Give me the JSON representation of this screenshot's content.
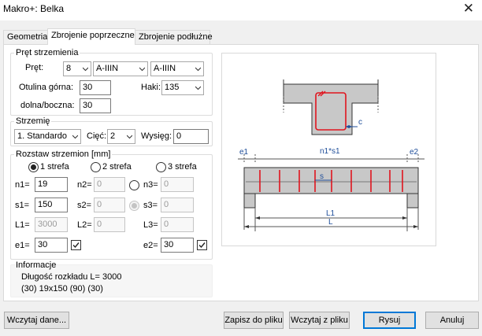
{
  "window": {
    "title": "Makro+: Belka",
    "close_glyph": "✕"
  },
  "tabs": [
    {
      "label": "Geometria"
    },
    {
      "label": "Zbrojenie poprzeczne"
    },
    {
      "label": "Zbrojenie podłużne"
    }
  ],
  "active_tab": 1,
  "pret": {
    "legend": "Pręt strzemienia",
    "pret_label": "Pręt:",
    "pret_value": "8",
    "steel1": "A-IIIN",
    "steel2": "A-IIIN",
    "otulina_gorna_label": "Otulina górna:",
    "otulina_gorna_value": "30",
    "haki_label": "Haki:",
    "haki_value": "135",
    "dolna_label": "dolna/boczna:",
    "dolna_value": "30"
  },
  "strzemie": {
    "legend": "Strzemię",
    "type_value": "1. Standardo",
    "ciec_label": "Cięć:",
    "ciec_value": "2",
    "wysieg_label": "Wysięg:",
    "wysieg_value": "0"
  },
  "rozstaw": {
    "legend": "Rozstaw strzemion [mm]",
    "strefa1": "1 strefa",
    "strefa2": "2 strefa",
    "strefa3": "3 strefa",
    "selected_strefa": 1,
    "n1_label": "n1=",
    "n1": "19",
    "n2_label": "n2=",
    "n2": "0",
    "n3_label": "n3=",
    "n3": "0",
    "s1_label": "s1=",
    "s1": "150",
    "s2_label": "s2=",
    "s2": "0",
    "s3_label": "s3=",
    "s3": "0",
    "L1_label": "L1=",
    "L1": "3000",
    "L2_label": "L2=",
    "L2": "0",
    "L3_label": "L3=",
    "L3": "0",
    "e1_label": "e1=",
    "e1": "30",
    "e1_checked": true,
    "e2_label": "e2=",
    "e2": "30",
    "e2_checked": true
  },
  "informacje": {
    "legend": "Informacje",
    "line1": "Długość rozkładu L= 3000",
    "line2": "(30) 19x150 (90) (30)"
  },
  "diagram": {
    "label_c": "c",
    "label_e1": "e1",
    "label_e2": "e2",
    "label_ns": "n1*s1",
    "label_s": "s",
    "label_L1": "L1",
    "label_L": "L",
    "colors": {
      "rebar": "#e0141e",
      "dim": "#1f4e9a",
      "concrete": "#c8c8c8",
      "outline": "#333333"
    }
  },
  "buttons": {
    "wczytaj_dane": "Wczytaj dane...",
    "zapisz": "Zapisz do pliku",
    "wczytaj_z_pliku": "Wczytaj z pliku",
    "rysuj": "Rysuj",
    "anuluj": "Anuluj"
  }
}
